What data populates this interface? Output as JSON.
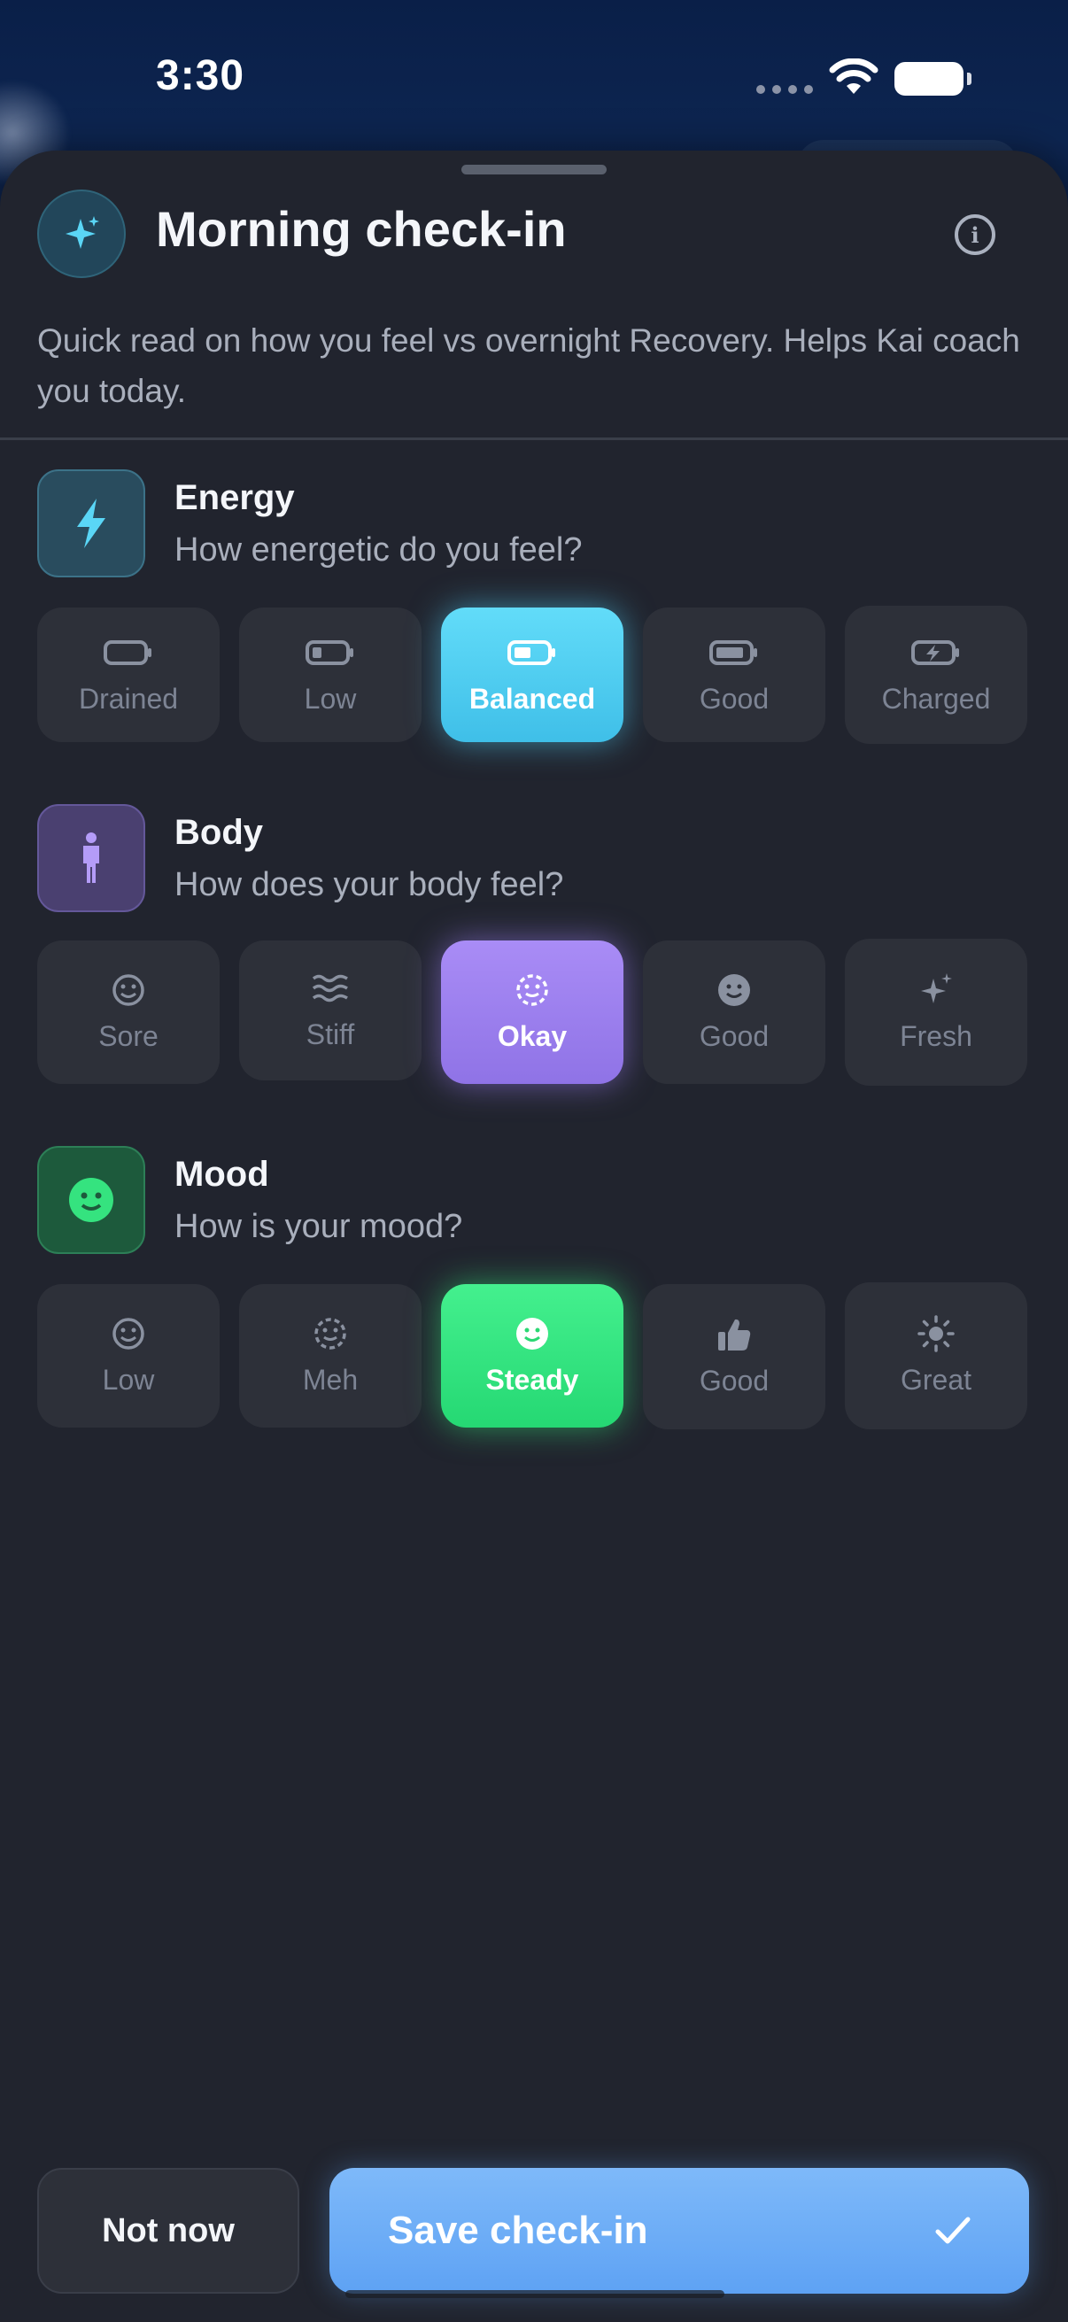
{
  "status_bar": {
    "time": "3:30"
  },
  "sheet": {
    "title": "Morning check-in",
    "subtitle": "Quick read on how you feel vs overnight Recovery. Helps Kai coach you today."
  },
  "sections": [
    {
      "title": "Energy",
      "question": "How energetic do you feel?",
      "accent": "#5ad6f6",
      "options": [
        "Drained",
        "Low",
        "Balanced",
        "Good",
        "Charged"
      ],
      "selected": "Balanced"
    },
    {
      "title": "Body",
      "question": "How does your body feel?",
      "accent": "#a086f2",
      "options": [
        "Sore",
        "Stiff",
        "Okay",
        "Good",
        "Fresh"
      ],
      "selected": "Okay"
    },
    {
      "title": "Mood",
      "question": "How is your mood?",
      "accent": "#35e37f",
      "options": [
        "Low",
        "Meh",
        "Steady",
        "Good",
        "Great"
      ],
      "selected": "Steady"
    }
  ],
  "footer": {
    "not_now_label": "Not now",
    "save_label": "Save check-in"
  }
}
